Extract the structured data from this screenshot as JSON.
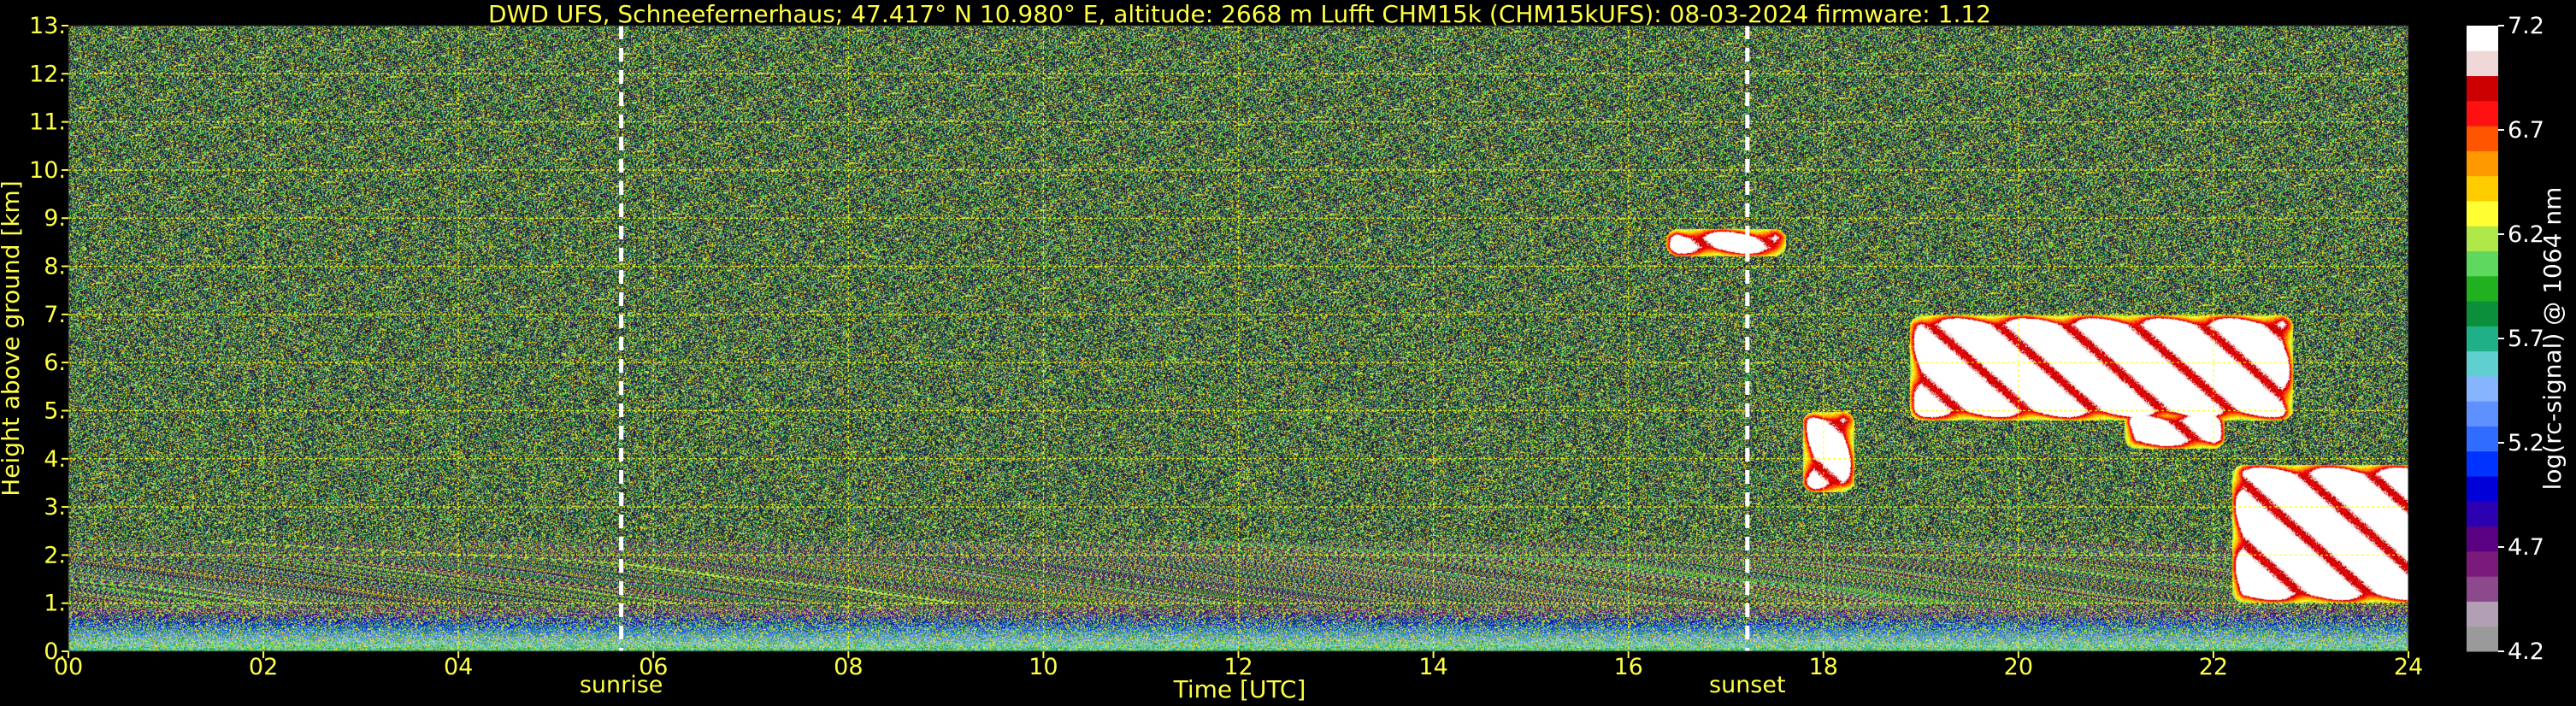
{
  "chart_data": {
    "type": "heatmap",
    "title": "DWD UFS, Schneefernerhaus; 47.417° N 10.980° E, altitude: 2668 m    Lufft CHM15k (CHM15kUFS): 08-03-2024    firmware: 1.12",
    "xlabel": "Time [UTC]",
    "ylabel": "Height above ground [km]",
    "colorbar_label": "log(rc-signal) @ 1064 nm",
    "xlim": [
      0,
      24
    ],
    "ylim": [
      0,
      13
    ],
    "x_ticks": [
      "00",
      "02",
      "04",
      "06",
      "08",
      "10",
      "12",
      "14",
      "16",
      "18",
      "20",
      "22",
      "24"
    ],
    "y_ticks": [
      "0.",
      "1.",
      "2.",
      "3.",
      "4.",
      "5.",
      "6.",
      "7.",
      "8.",
      "9.",
      "10.",
      "11.",
      "12.",
      "13."
    ],
    "colorbar_ticks": [
      "4.2",
      "4.7",
      "5.2",
      "5.7",
      "6.2",
      "6.7",
      "7.2"
    ],
    "colorbar_range": [
      4.2,
      7.2
    ],
    "grid": true,
    "grid_color": "#ffff00",
    "annotations": [
      {
        "label": "sunrise",
        "time_utc": 5.67
      },
      {
        "label": "sunset",
        "time_utc": 17.22
      }
    ],
    "colormap": [
      "#9a9a9a",
      "#b39fb3",
      "#8c4a8c",
      "#7a1a7a",
      "#5a0082",
      "#2a00b0",
      "#0000d8",
      "#0033ff",
      "#2f6cff",
      "#5f90ff",
      "#86b4ff",
      "#5fcfd0",
      "#20b088",
      "#0c8f3a",
      "#20b020",
      "#5fd85f",
      "#b0e84a",
      "#ffff33",
      "#ffcc00",
      "#ff9900",
      "#ff5500",
      "#ff1111",
      "#cc0000",
      "#f0d8d8",
      "#ffffff"
    ],
    "features": [
      {
        "name": "boundary layer aerosol",
        "t_start": 0,
        "t_end": 24,
        "h_bottom": 0,
        "h_top": 0.9
      },
      {
        "name": "cloud band",
        "t_start": 19.0,
        "t_end": 22.7,
        "h_bottom": 5.0,
        "h_top": 6.8
      },
      {
        "name": "cloud fragment",
        "t_start": 17.9,
        "t_end": 18.2,
        "h_bottom": 3.5,
        "h_top": 4.8
      },
      {
        "name": "cloud patch",
        "t_start": 21.2,
        "t_end": 22.0,
        "h_bottom": 4.4,
        "h_top": 4.8
      },
      {
        "name": "low cloud",
        "t_start": 22.3,
        "t_end": 24,
        "h_bottom": 1.2,
        "h_top": 3.7
      },
      {
        "name": "thin layer",
        "t_start": 16.5,
        "t_end": 17.5,
        "h_bottom": 8.4,
        "h_top": 8.6
      }
    ]
  }
}
